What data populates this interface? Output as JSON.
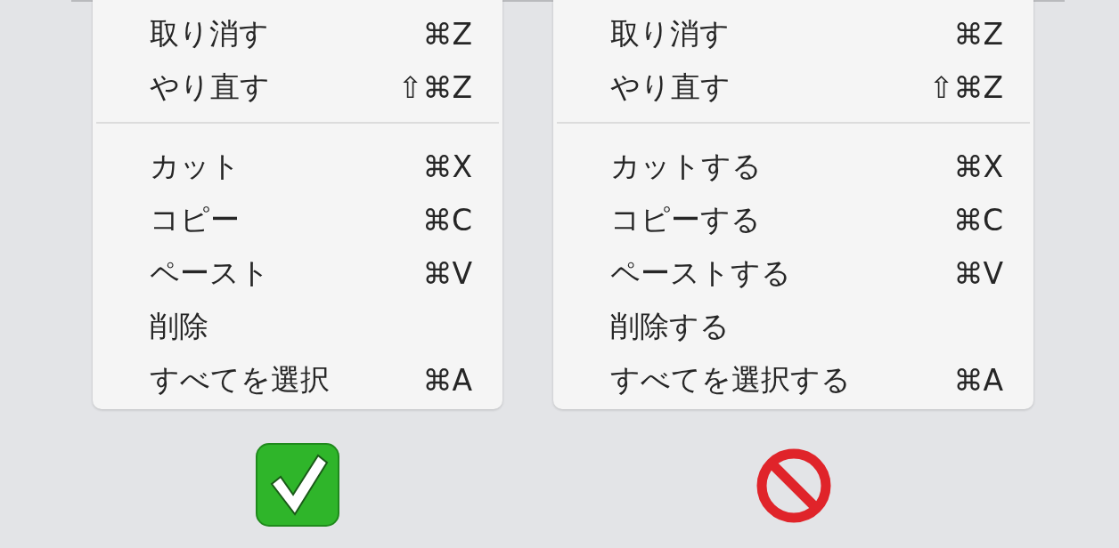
{
  "menus": [
    {
      "kind": "good",
      "items": [
        {
          "kind": "item",
          "label": "取り消す",
          "shortcut": "⌘Z"
        },
        {
          "kind": "item",
          "label": "やり直す",
          "shortcut": "⇧⌘Z"
        },
        {
          "kind": "separator"
        },
        {
          "kind": "item",
          "label": "カット",
          "shortcut": "⌘X"
        },
        {
          "kind": "item",
          "label": "コピー",
          "shortcut": "⌘C"
        },
        {
          "kind": "item",
          "label": "ペースト",
          "shortcut": "⌘V"
        },
        {
          "kind": "item",
          "label": "削除"
        },
        {
          "kind": "item",
          "label": "すべてを選択",
          "shortcut": "⌘A"
        }
      ]
    },
    {
      "kind": "bad",
      "items": [
        {
          "kind": "item",
          "label": "取り消す",
          "shortcut": "⌘Z"
        },
        {
          "kind": "item",
          "label": "やり直す",
          "shortcut": "⇧⌘Z"
        },
        {
          "kind": "separator"
        },
        {
          "kind": "item",
          "label": "カットする",
          "shortcut": "⌘X"
        },
        {
          "kind": "item",
          "label": "コピーする",
          "shortcut": "⌘C"
        },
        {
          "kind": "item",
          "label": "ペーストする",
          "shortcut": "⌘V"
        },
        {
          "kind": "item",
          "label": "削除する"
        },
        {
          "kind": "item",
          "label": "すべてを選択する",
          "shortcut": "⌘A"
        }
      ]
    }
  ]
}
